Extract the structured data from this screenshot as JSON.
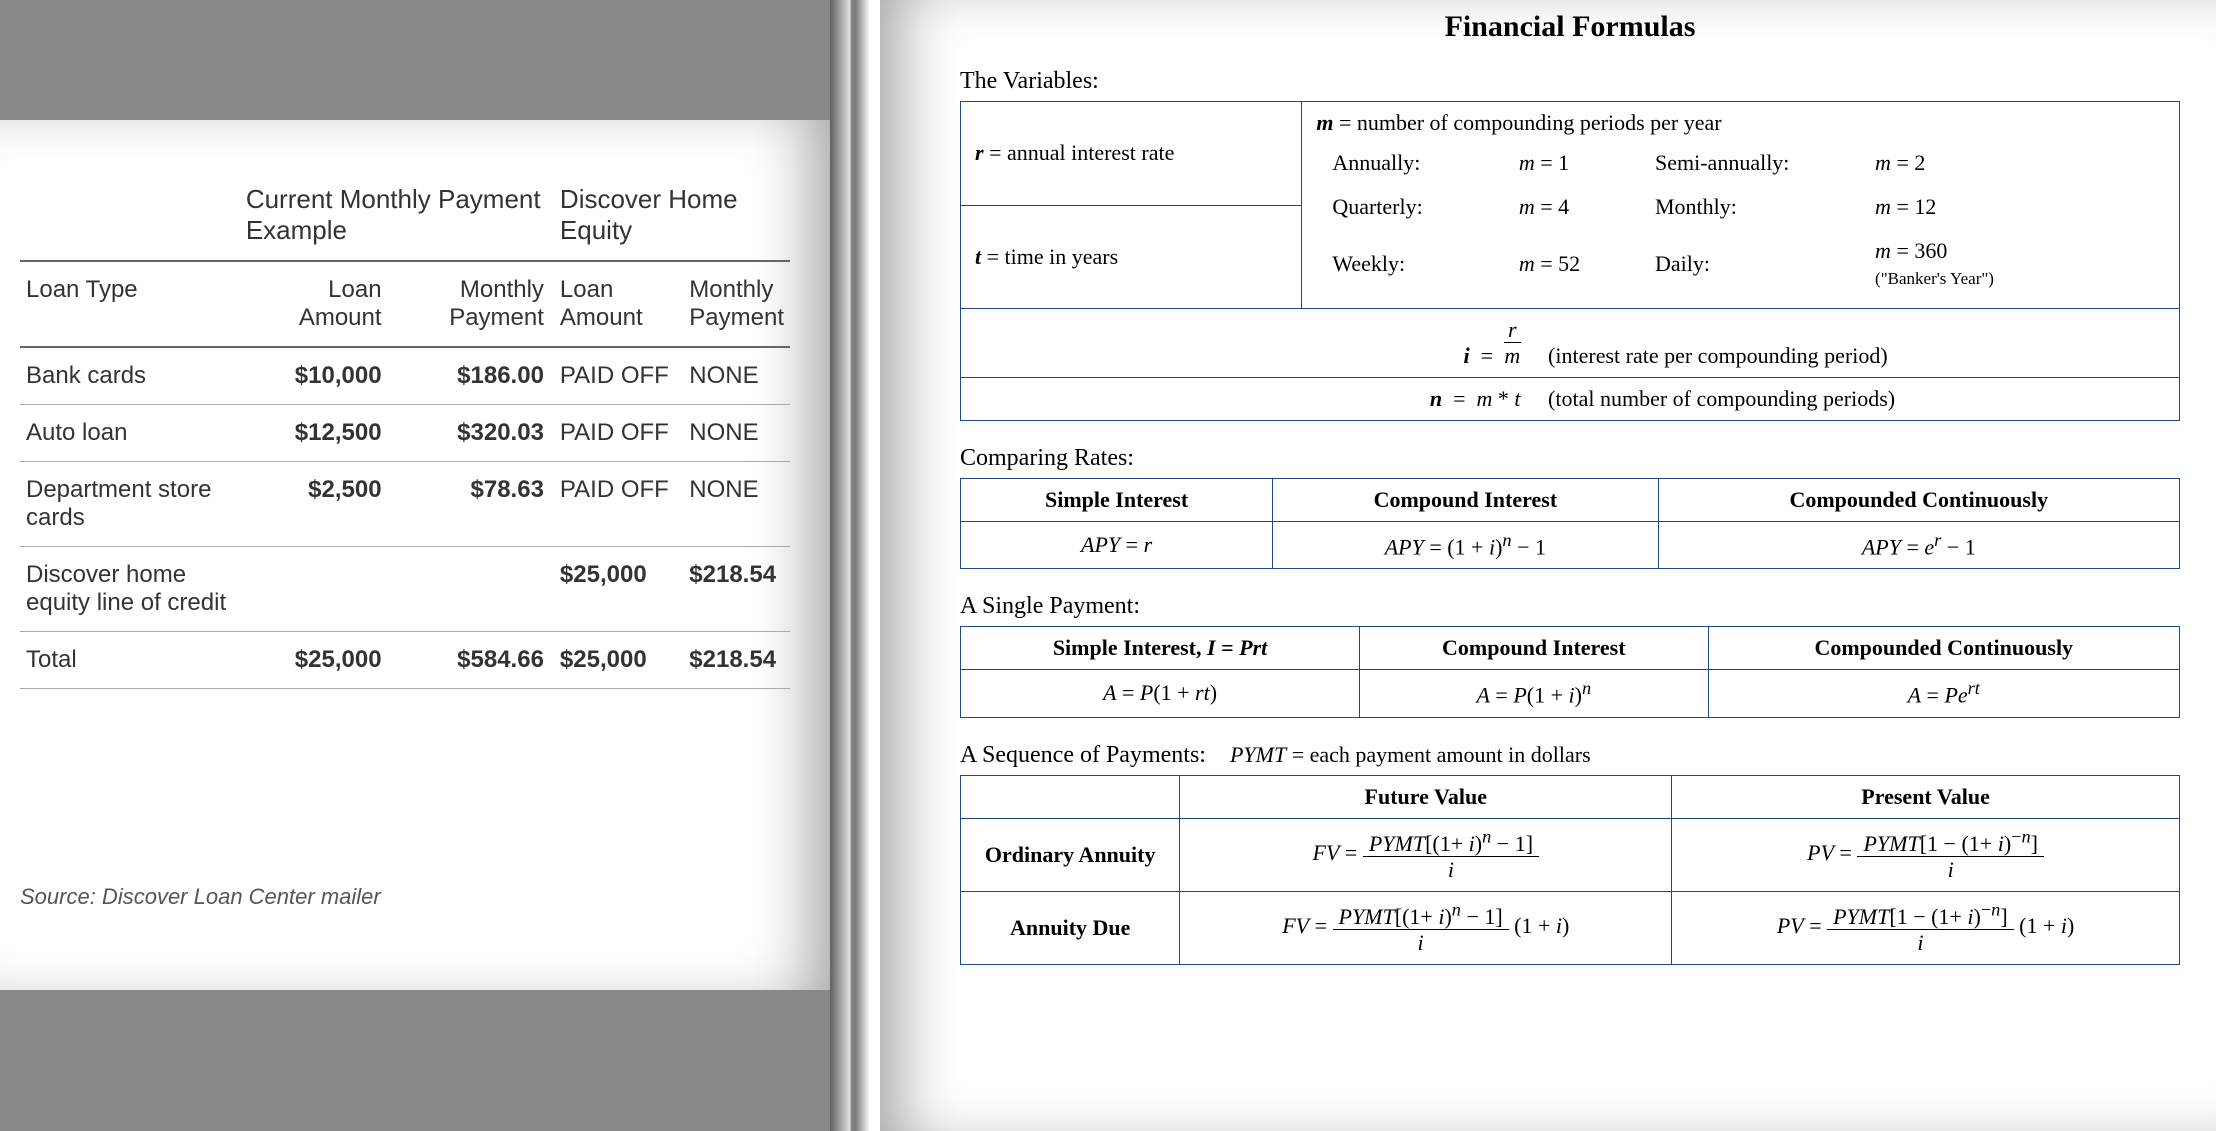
{
  "left": {
    "headers": {
      "group1": "Current Monthly Payment Example",
      "group2": "Discover Home Equity",
      "col0": "Loan Type",
      "col1": "Loan Amount",
      "col2": "Monthly Payment",
      "col3": "Loan Amount",
      "col4": "Monthly Payment"
    },
    "rows": [
      {
        "type": "Bank cards",
        "la": "$10,000",
        "mp": "$186.00",
        "la2": "PAID OFF",
        "mp2": "NONE"
      },
      {
        "type": "Auto loan",
        "la": "$12,500",
        "mp": "$320.03",
        "la2": "PAID OFF",
        "mp2": "NONE"
      },
      {
        "type": "Department store cards",
        "la": "$2,500",
        "mp": "$78.63",
        "la2": "PAID OFF",
        "mp2": "NONE"
      },
      {
        "type": "Discover home equity line of credit",
        "la": "",
        "mp": "",
        "la2": "$25,000",
        "mp2": "$218.54"
      },
      {
        "type": "Total",
        "la": "$25,000",
        "mp": "$584.66",
        "la2": "$25,000",
        "mp2": "$218.54"
      }
    ],
    "source": "Source: Discover Loan Center mailer"
  },
  "right": {
    "title": "Financial Formulas",
    "sec_vars": "The Variables:",
    "vars": {
      "r_def": "r = annual interest rate",
      "t_def": "t = time in years",
      "m_def": "m = number of compounding periods per year",
      "periods": [
        {
          "label": "Annually:",
          "val": "m = 1"
        },
        {
          "label": "Semi-annually:",
          "val": "m = 2"
        },
        {
          "label": "Quarterly:",
          "val": "m = 4"
        },
        {
          "label": "Monthly:",
          "val": "m = 12"
        },
        {
          "label": "Weekly:",
          "val": "m = 52"
        },
        {
          "label": "Daily:",
          "val": "m = 360"
        }
      ],
      "bankers": "(\"Banker's Year\")",
      "i_def_l": "i  =  r / m",
      "i_def_r": "(interest rate per compounding period)",
      "n_def_l": "n  =  m * t",
      "n_def_r": "(total number of compounding periods)"
    },
    "sec_rates": "Comparing Rates:",
    "rates": {
      "h1": "Simple Interest",
      "h2": "Compound Interest",
      "h3": "Compounded Continuously",
      "f1": "APY = r",
      "f2": "APY = (1 + i)ⁿ − 1",
      "f3": "APY = eʳ − 1"
    },
    "sec_single": "A Single Payment:",
    "single": {
      "h1": "Simple Interest, I = Prt",
      "h2": "Compound Interest",
      "h3": "Compounded Continuously",
      "f1": "A = P(1 + rt)",
      "f2": "A = P(1 + i)ⁿ",
      "f3": "A = Peʳᵗ"
    },
    "sec_seq": "A Sequence of Payments:",
    "seq_note": "PYMT = each payment amount in dollars",
    "seq": {
      "colFV": "Future Value",
      "colPV": "Present Value",
      "row1": "Ordinary Annuity",
      "fv1": "FV = PYMT[(1+ i)ⁿ − 1] / i",
      "pv1": "PV = PYMT[1 − (1+ i)⁻ⁿ] / i",
      "row2": "Annuity Due",
      "fv2": "FV = ( PYMT[(1+ i)ⁿ − 1] / i )·(1 + i)",
      "pv2": "PV = ( PYMT[1 − (1+ i)⁻ⁿ] / i )·(1 + i)"
    }
  }
}
